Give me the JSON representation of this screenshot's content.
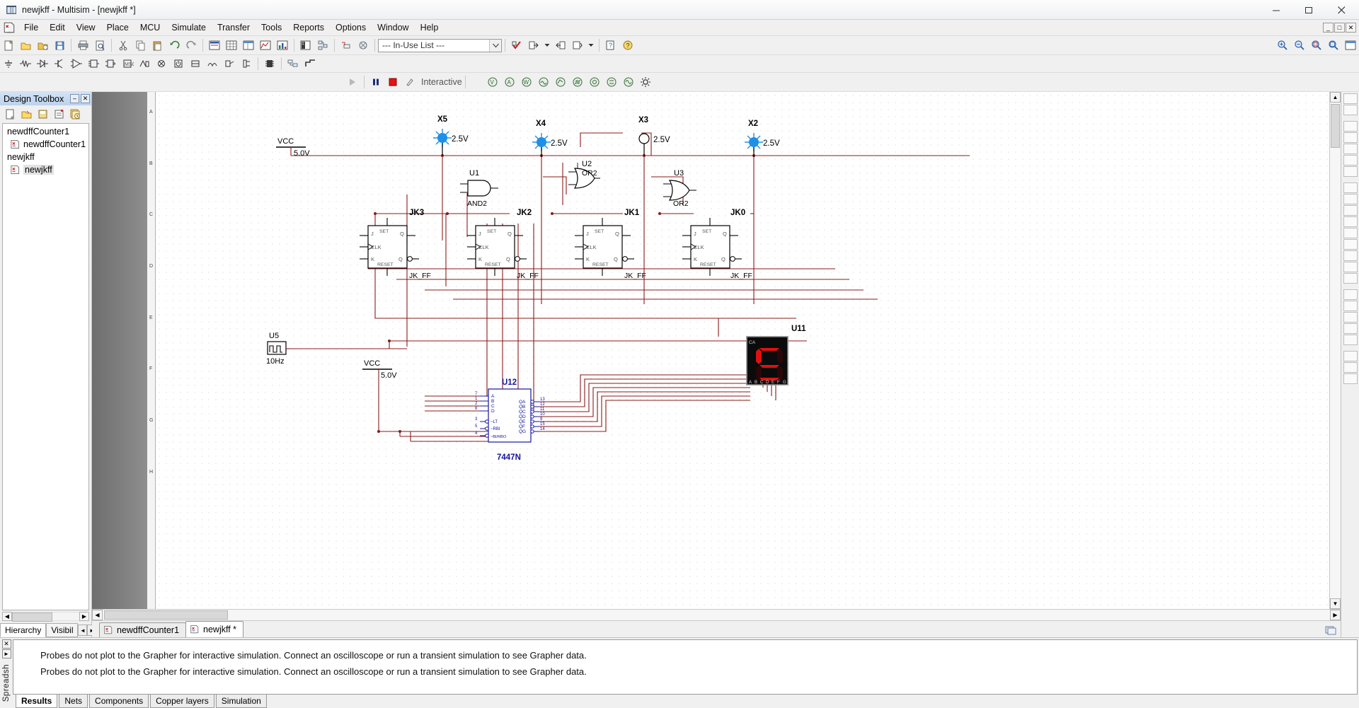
{
  "window": {
    "title": "newjkff - Multisim - [newjkff *]",
    "icon": "multisim-icon",
    "buttons": {
      "minimize": "minimize-icon",
      "maximize": "maximize-icon",
      "close": "close-icon"
    }
  },
  "menubar": {
    "items": [
      "File",
      "Edit",
      "View",
      "Place",
      "MCU",
      "Simulate",
      "Transfer",
      "Tools",
      "Reports",
      "Options",
      "Window",
      "Help"
    ],
    "doc_buttons": [
      "_",
      "□",
      "✕"
    ]
  },
  "toolbar": {
    "in_use_list": {
      "value": "--- In-Use List ---",
      "placeholder": "--- In-Use List ---"
    },
    "simulation": {
      "run_label": "run-icon",
      "pause_label": "pause-icon",
      "stop_label": "stop-icon",
      "mode": "Interactive"
    }
  },
  "toolbox": {
    "title": "Design Toolbox",
    "collapse": "–",
    "close": "✕",
    "tree": [
      {
        "label": "newdffCounter1",
        "type": "root"
      },
      {
        "label": "newdffCounter1",
        "type": "child"
      },
      {
        "label": "newjkff",
        "type": "root"
      },
      {
        "label": "newjkff",
        "type": "child",
        "selected": true
      }
    ],
    "tabs": [
      {
        "label": "Hierarchy",
        "active": true
      },
      {
        "label": "Visibil",
        "active": false
      }
    ],
    "tab_nav": [
      "◄",
      "►"
    ]
  },
  "canvas": {
    "ruler_labels": [
      "A",
      "B",
      "C",
      "D",
      "E",
      "F",
      "G",
      "H"
    ],
    "vcc_supplies": [
      {
        "label": "VCC",
        "value": "5.0V"
      },
      {
        "label": "VCC",
        "value": "5.0V"
      }
    ],
    "probes": [
      {
        "name": "X5",
        "value": "2.5V",
        "state": "on"
      },
      {
        "name": "X4",
        "value": "2.5V",
        "state": "on"
      },
      {
        "name": "X3",
        "value": "2.5V",
        "state": "off"
      },
      {
        "name": "X2",
        "value": "2.5V",
        "state": "on"
      }
    ],
    "gates": [
      {
        "ref": "U1",
        "type": "AND2"
      },
      {
        "ref": "U2",
        "type": "OR2"
      },
      {
        "ref": "U3",
        "type": "OR2"
      }
    ],
    "flipflops": [
      {
        "ref": "JK3",
        "model": "JK_FF",
        "pins": {
          "set": "SET",
          "j": "J",
          "clk": "CLK",
          "k": "K",
          "reset": "RESET",
          "q": "Q",
          "qbar": "Q"
        },
        "body": "JKRST"
      },
      {
        "ref": "JK2",
        "model": "JK_FF",
        "pins": {
          "set": "SET",
          "j": "J",
          "clk": "CLK",
          "k": "K",
          "reset": "RESET",
          "q": "Q",
          "qbar": "Q"
        },
        "body": "JKRST"
      },
      {
        "ref": "JK1",
        "model": "JK_FF",
        "pins": {
          "set": "SET",
          "j": "J",
          "clk": "CLK",
          "k": "K",
          "reset": "RESET",
          "q": "Q",
          "qbar": "Q"
        },
        "body": "JKRST"
      },
      {
        "ref": "JK0",
        "model": "JK_FF",
        "pins": {
          "set": "SET",
          "j": "J",
          "clk": "CLK",
          "k": "K",
          "reset": "RESET",
          "q": "Q",
          "qbar": "Q"
        },
        "body": "JKRST"
      }
    ],
    "clock": {
      "ref": "U5",
      "value": "10Hz"
    },
    "decoder": {
      "ref": "U12",
      "part": "7447N",
      "inputs": [
        "A",
        "B",
        "C",
        "D",
        "~LT",
        "~RBI",
        "~BI/RBO"
      ],
      "outputs": [
        "QA",
        "QB",
        "QC",
        "QD",
        "QE",
        "QF",
        "QG"
      ],
      "left_pin_numbers": [
        "7",
        "1",
        "2",
        "6",
        "3",
        "5",
        "4"
      ],
      "right_pin_numbers": [
        "13",
        "12",
        "11",
        "10",
        "9",
        "15",
        "14"
      ]
    },
    "display": {
      "ref": "U11",
      "common": "CA",
      "segment_labels": [
        "A",
        "B",
        "C",
        "D",
        "E",
        "F",
        "G"
      ],
      "lit_segments": [
        "a",
        "f",
        "g",
        "d"
      ]
    }
  },
  "sheet_tabs": [
    {
      "label": "newdffCounter1",
      "active": false,
      "icon": "schematic-icon"
    },
    {
      "label": "newjkff *",
      "active": true,
      "icon": "schematic-icon"
    }
  ],
  "spreadsheet": {
    "side_label": "Spreadsh",
    "close": "✕",
    "collapse": "►",
    "messages": [
      "Probes do not plot to the Grapher for interactive simulation. Connect an oscilloscope or run a transient simulation to see Grapher data.",
      "Probes do not plot to the Grapher for interactive simulation. Connect an oscilloscope or run a transient simulation to see Grapher data."
    ],
    "tabs": [
      {
        "label": "Results",
        "active": true
      },
      {
        "label": "Nets",
        "active": false
      },
      {
        "label": "Components",
        "active": false
      },
      {
        "label": "Copper layers",
        "active": false
      },
      {
        "label": "Simulation",
        "active": false
      }
    ]
  },
  "colors": {
    "wire": "#8B1A1A",
    "probe_on": "#1E90E8",
    "component": "#000000",
    "decoder_blue": "#1414A0",
    "segment_on": "#E01010",
    "title_accent": "#bcd2ec"
  }
}
